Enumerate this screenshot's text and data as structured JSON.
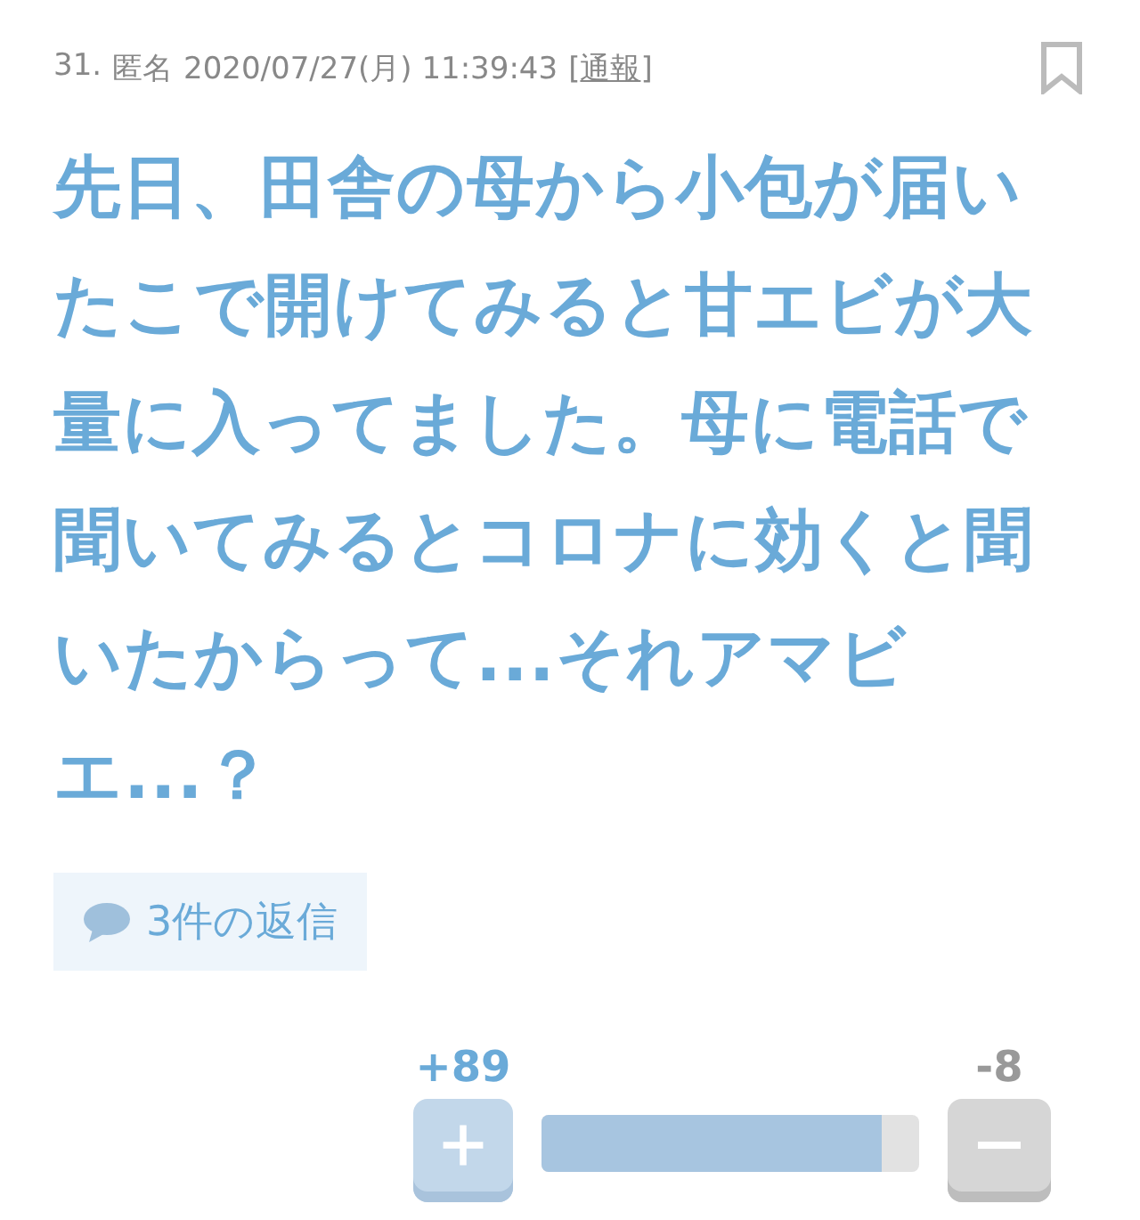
{
  "comment": {
    "number": "31.",
    "author": "匿名",
    "datetime": "2020/07/27(月) 11:39:43",
    "report_link": {
      "open": "[",
      "label": "通報",
      "close": "]"
    },
    "bookmarked": false,
    "body_lines": [
      "先日、田舎の母から小包が届い",
      "たこで開けてみると甘エビが大",
      "量に入ってました。母に電話で",
      "聞いてみるとコロナに効くと聞",
      "いたからって...それアマビ",
      "エ...？"
    ],
    "replies": "3件の返信"
  },
  "vote": {
    "plus": "+89",
    "minus": "-8",
    "level": 0.9
  }
}
